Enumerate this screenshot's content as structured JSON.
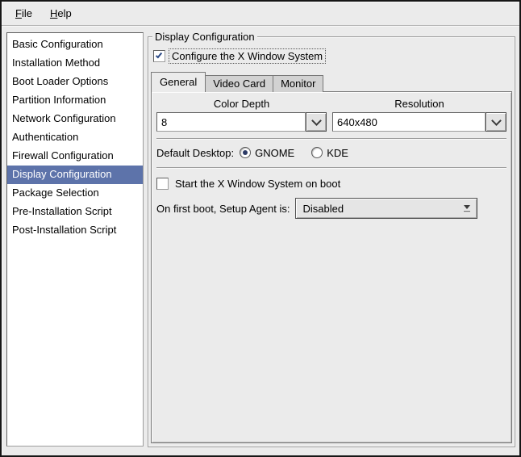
{
  "colors": {
    "window_bg": "#ebebeb",
    "highlight": "#5d73aa",
    "check_blue": "#2d4b87"
  },
  "menubar": {
    "items": [
      {
        "label": "File",
        "mnemonic": "F",
        "rest": "ile"
      },
      {
        "label": "Help",
        "mnemonic": "H",
        "rest": "elp"
      }
    ]
  },
  "sidebar": {
    "items": [
      {
        "label": "Basic Configuration",
        "selected": false
      },
      {
        "label": "Installation Method",
        "selected": false
      },
      {
        "label": "Boot Loader Options",
        "selected": false
      },
      {
        "label": "Partition Information",
        "selected": false
      },
      {
        "label": "Network Configuration",
        "selected": false
      },
      {
        "label": "Authentication",
        "selected": false
      },
      {
        "label": "Firewall Configuration",
        "selected": false
      },
      {
        "label": "Display Configuration",
        "selected": true
      },
      {
        "label": "Package Selection",
        "selected": false
      },
      {
        "label": "Pre-Installation Script",
        "selected": false
      },
      {
        "label": "Post-Installation Script",
        "selected": false
      }
    ]
  },
  "display_config": {
    "frame_title": "Display Configuration",
    "configure_x": {
      "label": "Configure the X Window System",
      "checked": true
    },
    "tabs": [
      {
        "label": "General",
        "active": true
      },
      {
        "label": "Video Card",
        "active": false
      },
      {
        "label": "Monitor",
        "active": false
      }
    ],
    "general": {
      "color_depth_label": "Color Depth",
      "color_depth_value": "8",
      "resolution_label": "Resolution",
      "resolution_value": "640x480",
      "default_desktop_label": "Default Desktop:",
      "desktop_options": [
        {
          "label": "GNOME",
          "selected": true
        },
        {
          "label": "KDE",
          "selected": false
        }
      ],
      "start_x": {
        "label": "Start the X Window System on boot",
        "checked": false
      },
      "setup_agent_label": "On first boot, Setup Agent is:",
      "setup_agent_value": "Disabled"
    }
  }
}
